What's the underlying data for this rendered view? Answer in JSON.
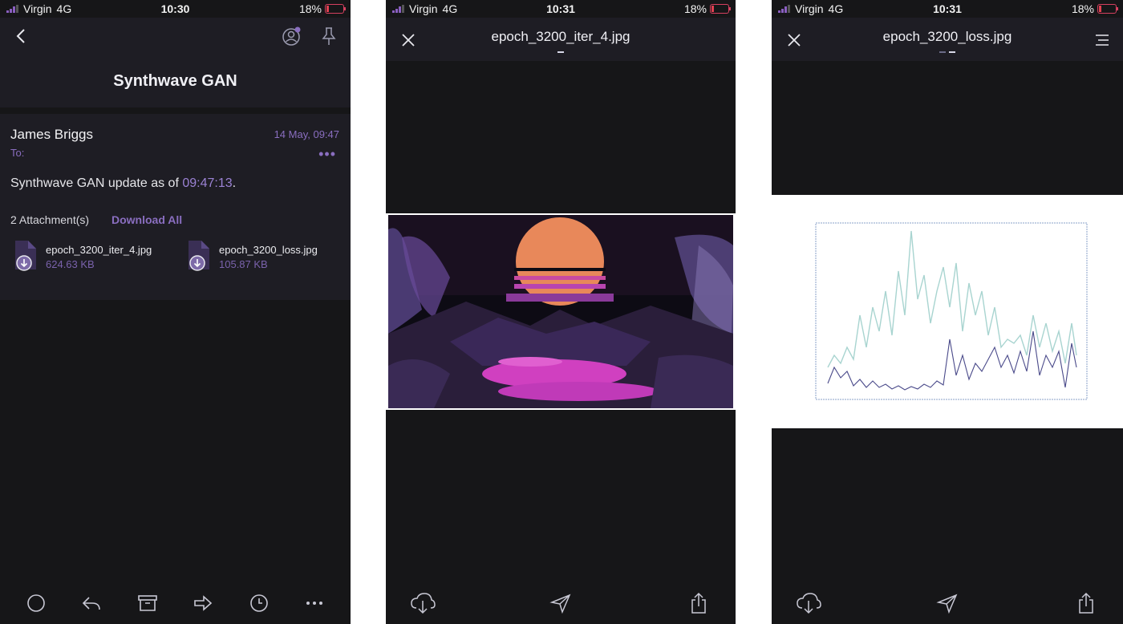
{
  "status_bars": [
    {
      "carrier": "Virgin",
      "network": "4G",
      "time": "10:30",
      "battery": "18%"
    },
    {
      "carrier": "Virgin",
      "network": "4G",
      "time": "10:31",
      "battery": "18%"
    },
    {
      "carrier": "Virgin",
      "network": "4G",
      "time": "10:31",
      "battery": "18%"
    }
  ],
  "email": {
    "subject": "Synthwave GAN",
    "sender": "James Briggs",
    "date": "14 May, 09:47",
    "to_label": "To:",
    "body_prefix": "Synthwave GAN update as of ",
    "body_time": "09:47:13",
    "body_suffix": ".",
    "attachments_label": "2 Attachment(s)",
    "download_all": "Download All",
    "attachments": [
      {
        "name": "epoch_3200_iter_4.jpg",
        "size": "624.63 KB"
      },
      {
        "name": "epoch_3200_loss.jpg",
        "size": "105.87 KB"
      }
    ]
  },
  "viewer_1": {
    "filename": "epoch_3200_iter_4.jpg"
  },
  "viewer_2": {
    "filename": "epoch_3200_loss.jpg"
  },
  "colors": {
    "accent": "#8a6ec0",
    "background": "#161618",
    "header": "#1e1d24"
  },
  "icons": [
    "back-icon",
    "avatar-icon",
    "pin-icon",
    "circle-icon",
    "reply-icon",
    "archive-icon",
    "forward-icon",
    "clock-icon",
    "more-icon",
    "close-icon",
    "menu-icon",
    "download-cloud-icon",
    "send-icon",
    "share-icon",
    "file-download-icon"
  ]
}
